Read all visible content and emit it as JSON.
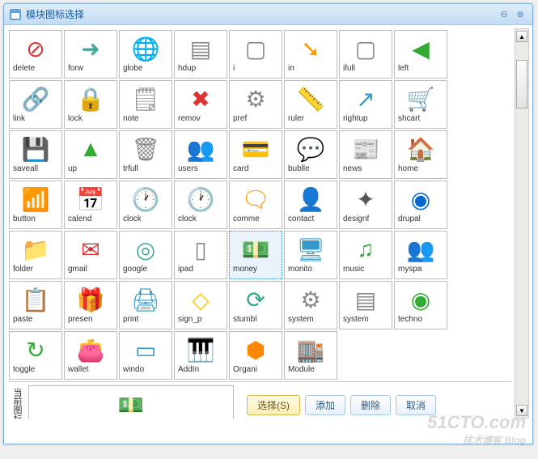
{
  "window": {
    "title": "模块图标选择"
  },
  "icons": [
    {
      "label": "delete",
      "name": "delete-icon",
      "fg": "#d33",
      "sym": "⊘"
    },
    {
      "label": "forw",
      "name": "forward-icon",
      "fg": "#4a9",
      "sym": "➜"
    },
    {
      "label": "globe",
      "name": "globe-icon",
      "fg": "#39c",
      "sym": "🌐"
    },
    {
      "label": "hdup",
      "name": "hdup-icon",
      "fg": "#888",
      "sym": "▤"
    },
    {
      "label": "i",
      "name": "info-icon",
      "fg": "#888",
      "sym": "▢"
    },
    {
      "label": "in",
      "name": "in-icon",
      "fg": "#f90",
      "sym": "➘"
    },
    {
      "label": "ifull",
      "name": "ifull-icon",
      "fg": "#888",
      "sym": "▢"
    },
    {
      "label": "left",
      "name": "left-icon",
      "fg": "#3a3",
      "sym": "◀"
    },
    {
      "label": "link",
      "name": "link-icon",
      "fg": "#888",
      "sym": "🔗"
    },
    {
      "label": "lock",
      "name": "lock-icon",
      "fg": "#da3",
      "sym": "🔒"
    },
    {
      "label": "note",
      "name": "note-icon",
      "fg": "#888",
      "sym": "🗒"
    },
    {
      "label": "remov",
      "name": "remove-icon",
      "fg": "#d33",
      "sym": "✖"
    },
    {
      "label": "pref",
      "name": "pref-icon",
      "fg": "#888",
      "sym": "⚙"
    },
    {
      "label": "ruler",
      "name": "ruler-icon",
      "fg": "#aaa",
      "sym": "📏"
    },
    {
      "label": "rightup",
      "name": "rightup-icon",
      "fg": "#39c",
      "sym": "↗"
    },
    {
      "label": "shcart",
      "name": "cart-icon",
      "fg": "#39c",
      "sym": "🛒"
    },
    {
      "label": "saveall",
      "name": "saveall-icon",
      "fg": "#39c",
      "sym": "💾"
    },
    {
      "label": "up",
      "name": "up-icon",
      "fg": "#3a3",
      "sym": "▲"
    },
    {
      "label": "trfull",
      "name": "trash-icon",
      "fg": "#888",
      "sym": "🗑"
    },
    {
      "label": "users",
      "name": "users-icon",
      "fg": "#da3",
      "sym": "👥"
    },
    {
      "label": "card",
      "name": "card-icon",
      "fg": "#39c",
      "sym": "💳"
    },
    {
      "label": "bublle",
      "name": "bubble-icon",
      "fg": "#3a3",
      "sym": "💬"
    },
    {
      "label": "news",
      "name": "news-icon",
      "fg": "#357",
      "sym": "📰"
    },
    {
      "label": "home",
      "name": "home-icon",
      "fg": "#d66",
      "sym": "🏠"
    },
    {
      "label": "button",
      "name": "rss-icon",
      "fg": "#f80",
      "sym": "📶"
    },
    {
      "label": "calend",
      "name": "calendar-icon",
      "fg": "#39c",
      "sym": "📅"
    },
    {
      "label": "clock",
      "name": "clock-icon",
      "fg": "#888",
      "sym": "🕐"
    },
    {
      "label": "clock",
      "name": "clock2-icon",
      "fg": "#39c",
      "sym": "🕐"
    },
    {
      "label": "comme",
      "name": "comment-icon",
      "fg": "#f90",
      "sym": "🗨"
    },
    {
      "label": "contact",
      "name": "contact-icon",
      "fg": "#39c",
      "sym": "👤"
    },
    {
      "label": "designf",
      "name": "design-icon",
      "fg": "#555",
      "sym": "✦"
    },
    {
      "label": "drupal",
      "name": "drupal-icon",
      "fg": "#06c",
      "sym": "◉"
    },
    {
      "label": "folder",
      "name": "folder-icon",
      "fg": "#39c",
      "sym": "📁"
    },
    {
      "label": "gmail",
      "name": "gmail-icon",
      "fg": "#d33",
      "sym": "✉"
    },
    {
      "label": "google",
      "name": "google-icon",
      "fg": "#4a9",
      "sym": "◎"
    },
    {
      "label": "ipad",
      "name": "ipad-icon",
      "fg": "#888",
      "sym": "▯"
    },
    {
      "label": "money",
      "name": "money-icon",
      "fg": "#3a3",
      "sym": "💵",
      "selected": true
    },
    {
      "label": "monito",
      "name": "monitor-icon",
      "fg": "#39c",
      "sym": "🖥"
    },
    {
      "label": "music",
      "name": "music-icon",
      "fg": "#3a3",
      "sym": "♫"
    },
    {
      "label": "myspa",
      "name": "myspace-icon",
      "fg": "#39c",
      "sym": "👥"
    },
    {
      "label": "paste",
      "name": "paste-icon",
      "fg": "#39c",
      "sym": "📋"
    },
    {
      "label": "presen",
      "name": "present-icon",
      "fg": "#39c",
      "sym": "🎁"
    },
    {
      "label": "print",
      "name": "print-icon",
      "fg": "#39c",
      "sym": "🖨"
    },
    {
      "label": "sign_p",
      "name": "sign-icon",
      "fg": "#fc0",
      "sym": "◇"
    },
    {
      "label": "stumbl",
      "name": "stumble-icon",
      "fg": "#3a8",
      "sym": "⟳"
    },
    {
      "label": "system",
      "name": "system-icon",
      "fg": "#888",
      "sym": "⚙"
    },
    {
      "label": "system",
      "name": "system2-icon",
      "fg": "#888",
      "sym": "▤"
    },
    {
      "label": "techno",
      "name": "techno-icon",
      "fg": "#3a3",
      "sym": "◉"
    },
    {
      "label": "toggle",
      "name": "toggle-icon",
      "fg": "#3a3",
      "sym": "↻"
    },
    {
      "label": "wallet",
      "name": "wallet-icon",
      "fg": "#c73",
      "sym": "👛"
    },
    {
      "label": "windo",
      "name": "window-icon",
      "fg": "#39c",
      "sym": "▭"
    },
    {
      "label": "AddIn",
      "name": "addin-icon",
      "fg": "#333",
      "sym": "🎹"
    },
    {
      "label": "Organi",
      "name": "organi-icon",
      "fg": "#f80",
      "sym": "⬢"
    },
    {
      "label": "Module",
      "name": "module-icon",
      "fg": "#39c",
      "sym": "🏬"
    }
  ],
  "footer": {
    "currentIconLabel": "当前图标",
    "buttons": {
      "select": "选择(S)",
      "add": "添加",
      "delete": "删除",
      "cancel": "取消"
    }
  },
  "preview": {
    "fg": "#3a3",
    "sym": "💵"
  },
  "watermark": {
    "main": "51CTO.com",
    "sub": "技术博客   Blog"
  }
}
